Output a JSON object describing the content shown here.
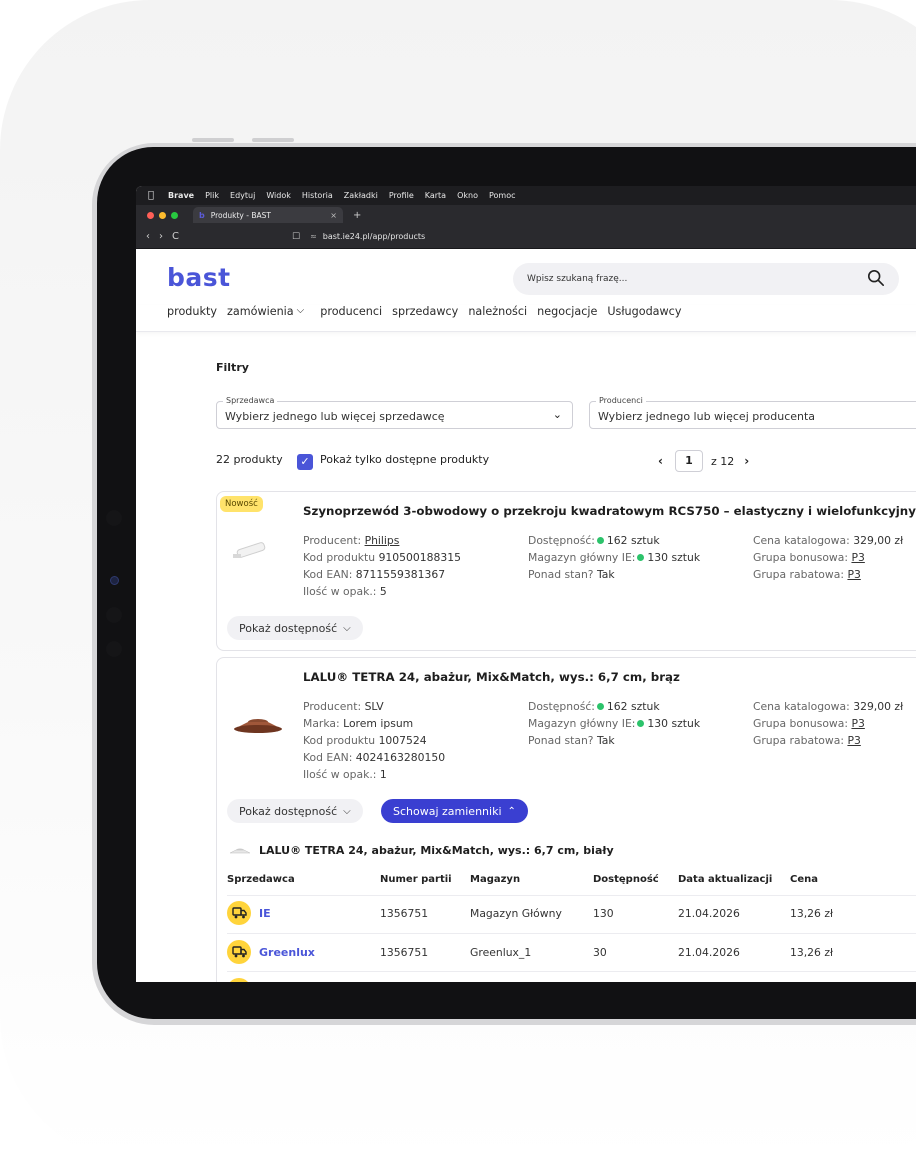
{
  "menubar": {
    "apple": "",
    "items": [
      "Brave",
      "Plik",
      "Edytuj",
      "Widok",
      "Historia",
      "Zakładki",
      "Profile",
      "Karta",
      "Okno",
      "Pomoc"
    ]
  },
  "browser": {
    "tab_favicon": "b",
    "tab_title": "Produkty - BAST",
    "tab_close": "×",
    "new_tab": "+",
    "back": "‹",
    "forward": "›",
    "reload": "C",
    "url": "bast.ie24.pl/app/products"
  },
  "header": {
    "logo": "bast",
    "search_placeholder": "Wpisz szukaną frazę...",
    "nav": [
      "produkty",
      "zamówienia",
      "producenci",
      "sprzedawcy",
      "należności",
      "negocjacje",
      "Usługodawcy"
    ],
    "nav_chevron": "❯"
  },
  "filters": {
    "title": "Filtry",
    "seller": {
      "label": "Sprzedawca",
      "placeholder": "Wybierz jednego lub więcej sprzedawcę"
    },
    "producer": {
      "label": "Producenci",
      "placeholder": "Wybierz jednego lub więcej producenta"
    },
    "count": "22 produkty",
    "only_available": "Pokaż tylko dostępne produkty",
    "only_available_checked": true,
    "page": "1",
    "of_pages": "z 12",
    "prev": "‹",
    "next": "›"
  },
  "products": [
    {
      "badge": "Nowość",
      "title": "Szynoprzewód 3-obwodowy o przekroju kwadratowym RCS750 – elastyczny i wielofunkcyjny",
      "col1": [
        {
          "label": "Producent:",
          "value": "Philips"
        },
        {
          "label": "Kod produktu",
          "value": "910500188315"
        },
        {
          "label": "Kod EAN:",
          "value": "8711559381367"
        },
        {
          "label": "Ilość w opak.:",
          "value": "5"
        }
      ],
      "col2": [
        {
          "label": "Dostępność:",
          "value": "162 sztuk"
        },
        {
          "label": "Magazyn główny IE:",
          "value": "130 sztuk"
        },
        {
          "label": "Ponad stan?",
          "value": "Tak"
        }
      ],
      "col3": [
        {
          "label": "Cena katalogowa:",
          "value": "329,00 zł"
        },
        {
          "label": "Grupa bonusowa:",
          "value": "P3"
        },
        {
          "label": "Grupa rabatowa:",
          "value": "P3"
        }
      ],
      "show_availability": "Pokaż dostępność"
    },
    {
      "title": "LALU® TETRA 24, abażur, Mix&Match, wys.: 6,7 cm, brąz",
      "col1": [
        {
          "label": "Producent:",
          "value": "SLV"
        },
        {
          "label": "Marka:",
          "value": "Lorem ipsum"
        },
        {
          "label": "Kod produktu",
          "value": "1007524"
        },
        {
          "label": "Kod EAN:",
          "value": "4024163280150"
        },
        {
          "label": "Ilość w opak.:",
          "value": "1"
        }
      ],
      "col2": [
        {
          "label": "Dostępność:",
          "value": "162 sztuk"
        },
        {
          "label": "Magazyn główny IE:",
          "value": "130 sztuk"
        },
        {
          "label": "Ponad stan?",
          "value": "Tak"
        }
      ],
      "col3": [
        {
          "label": "Cena katalogowa:",
          "value": "329,00 zł"
        },
        {
          "label": "Grupa bonusowa:",
          "value": "P3"
        },
        {
          "label": "Grupa rabatowa:",
          "value": "P3"
        }
      ],
      "show_availability": "Pokaż dostępność",
      "hide_replacements": "Schowaj zamienniki"
    }
  ],
  "replacement": {
    "title": "LALU® TETRA 24, abażur, Mix&Match, wys.: 6,7 cm, biały",
    "headers": [
      "Sprzedawca",
      "Numer partii",
      "Magazyn",
      "Dostępność",
      "Data aktualizacji",
      "Cena"
    ],
    "rows": [
      {
        "seller": "IE",
        "batch": "1356751",
        "warehouse": "Magazyn Główny",
        "availability": "130",
        "updated": "21.04.2026",
        "price": "13,26 zł"
      },
      {
        "seller": "Greenlux",
        "batch": "1356751",
        "warehouse": "Greenlux_1",
        "availability": "30",
        "updated": "21.04.2026",
        "price": "13,26 zł"
      }
    ]
  },
  "colors": {
    "brand": "#4a55d8",
    "accent_button": "#3a3fd1",
    "badge": "#ffe36b",
    "available": "#2cc36b",
    "truck": "#ffd43b"
  }
}
